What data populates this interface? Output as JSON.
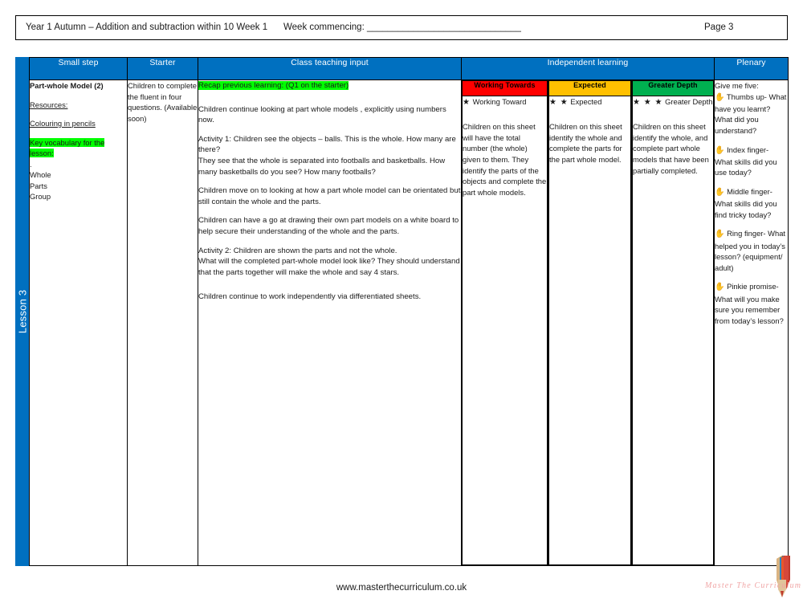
{
  "header": {
    "title": "Year 1 Autumn – Addition and subtraction within 10 Week 1",
    "week_commencing": "Week commencing: ______________________________",
    "page": "Page 3"
  },
  "lesson_tab": {
    "label": "Lesson 3",
    "color": "#0070c0"
  },
  "table": {
    "headers": [
      {
        "label": "Small step"
      },
      {
        "label": "Starter"
      },
      {
        "label": "Class teaching input"
      },
      {
        "label": "Independent learning"
      },
      {
        "label": "Plenary"
      }
    ],
    "header_color": "#0070c0",
    "small_step": {
      "title": "Part-whole Model (2)",
      "resources_label": "Resources:",
      "resource_item": "Colouring in pencils",
      "key_vocab_label": "Key vocabulary for the lesson:",
      "key_vocab_highlight": "#00ff00",
      "vocab_bullet": ".",
      "vocab": [
        "Whole",
        "Parts",
        "Group"
      ]
    },
    "starter": {
      "text": "Children to complete the fluent in four questions. (Available soon)"
    },
    "class_teaching_input": {
      "recap": "Recap previous learning: (Q1 on the starter)",
      "recap_highlight": "#00ff00",
      "paragraphs": [
        "Children continue looking at part whole models , explicitly using numbers now.",
        "Activity 1: Children see the objects – balls. This is the whole. How many are there?\nThey see that the whole is separated into footballs and basketballs. How many basketballs do you see? How many footballs?",
        "Children move on to looking at how a part whole model can be orientated but still contain the whole and the parts.",
        "Children can have a go at drawing their own part models on a white board to help secure their understanding of the whole and the parts.",
        "Activity 2: Children are shown the parts and not the whole.\nWhat will the completed part-whole model look like? They should understand that the parts together will make the whole and say 4 stars.",
        "Children continue to work independently via differentiated sheets."
      ]
    },
    "independent_learning": {
      "columns": [
        {
          "band_label": "Working Towards",
          "band_color": "#ff0000",
          "stars": "★",
          "star_label": "Working Toward",
          "body": "Children on this sheet will have the total number (the whole) given to them. They identify the parts of the objects and complete the part whole models."
        },
        {
          "band_label": "Expected",
          "band_color": "#ffc000",
          "stars": "★ ★",
          "star_label": "Expected",
          "body": "Children on this sheet identify the whole and complete the parts for the part whole model."
        },
        {
          "band_label": "Greater Depth",
          "band_color": "#00b050",
          "stars": "★ ★ ★",
          "star_label": "Greater Depth",
          "body": "Children on this sheet identify the whole, and complete part whole models that have been partially completed."
        }
      ]
    },
    "plenary": {
      "intro": "Give me five:",
      "items": [
        {
          "icon": "hand-icon",
          "text": "Thumbs up- What have you learnt? What did you understand?"
        },
        {
          "icon": "hand-icon",
          "text": "Index finger- What skills did you use today?"
        },
        {
          "icon": "hand-icon",
          "text": "Middle finger- What skills did you find tricky today?"
        },
        {
          "icon": "hand-icon",
          "text": "Ring finger- What helped you in today’s lesson? (equipment/ adult)"
        },
        {
          "icon": "hand-icon",
          "text": "Pinkie promise- What will you make sure you remember from today’s lesson?"
        }
      ],
      "hand_glyph": "✋"
    }
  },
  "footer": {
    "url": "www.masterthecurriculum.co.uk",
    "brand_wordmark": "Master The Curriculum"
  }
}
